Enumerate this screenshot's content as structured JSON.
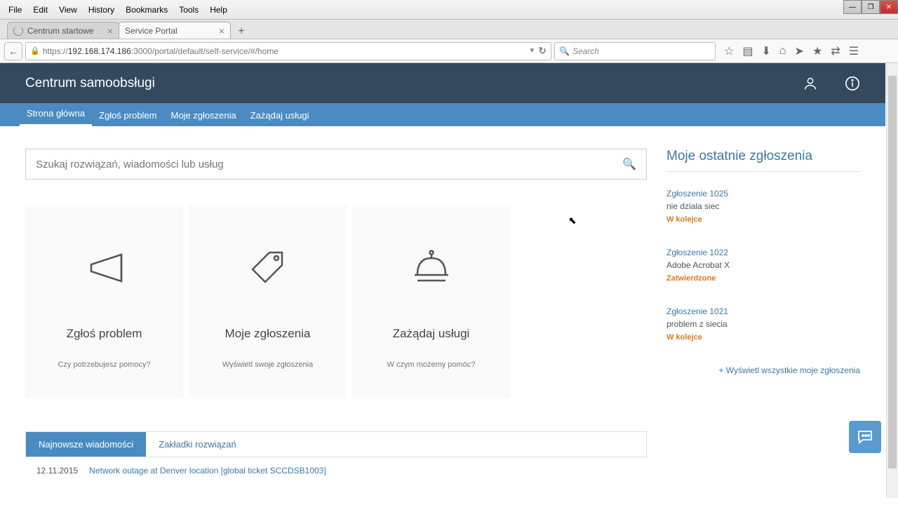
{
  "browser": {
    "menu": [
      "File",
      "Edit",
      "View",
      "History",
      "Bookmarks",
      "Tools",
      "Help"
    ],
    "tabs": [
      {
        "title": "Centrum startowe",
        "active": false
      },
      {
        "title": "Service Portal",
        "active": true
      }
    ],
    "url_host": "192.168.174.186",
    "url_rest": ":3000/portal/default/self-service/#/home",
    "search_placeholder": "Search"
  },
  "header": {
    "title": "Centrum samoobsługi"
  },
  "nav": [
    {
      "label": "Strona główna",
      "active": true
    },
    {
      "label": "Zgłoś problem",
      "active": false
    },
    {
      "label": "Moje zgłoszenia",
      "active": false
    },
    {
      "label": "Zażądaj usługi",
      "active": false
    }
  ],
  "search": {
    "placeholder": "Szukaj rozwiązań, wiadomości lub usług"
  },
  "cards": [
    {
      "title": "Zgłoś problem",
      "sub": "Czy potrzebujesz pomocy?"
    },
    {
      "title": "Moje zgłoszenia",
      "sub": "Wyświetl swoje zgłoszenia"
    },
    {
      "title": "Zażądaj usługi",
      "sub": "W czym możemy pomóc?"
    }
  ],
  "sidebar": {
    "title": "Moje ostatnie zgłoszenia",
    "tickets": [
      {
        "id": "Zgłoszenie 1025",
        "desc": "nie dziala siec",
        "status": "W kolejce"
      },
      {
        "id": "Zgłoszenie 1022",
        "desc": "Adobe Acrobat X",
        "status": "Zatwierdzone"
      },
      {
        "id": "Zgłoszenie 1021",
        "desc": "problem z siecia",
        "status": "W kolejce"
      }
    ],
    "view_all": "+ Wyświetl wszystkie moje zgłoszenia"
  },
  "bottom": {
    "tab1": "Najnowsze wiadomości",
    "tab2": "Zakładki rozwiązań",
    "news": {
      "date": "12.11.2015",
      "title": "Network outage at Denver location [global ticket SCCDSB1003]"
    }
  }
}
